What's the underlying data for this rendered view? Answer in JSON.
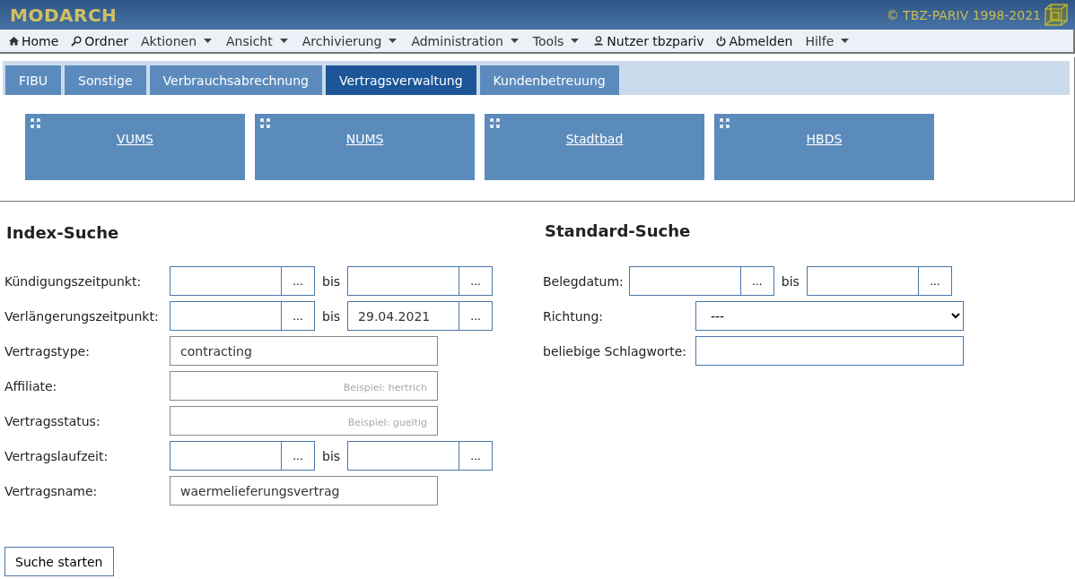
{
  "header": {
    "logo": "MODARCH",
    "copyright": "© TBZ-PARIV 1998-2021"
  },
  "menu": [
    {
      "label": "Home",
      "kind": "home"
    },
    {
      "label": "Ordner",
      "kind": "search"
    },
    {
      "label": "Aktionen",
      "kind": "dropdown"
    },
    {
      "label": "Ansicht",
      "kind": "dropdown"
    },
    {
      "label": "Archivierung",
      "kind": "dropdown"
    },
    {
      "label": "Administration",
      "kind": "dropdown"
    },
    {
      "label": "Tools",
      "kind": "dropdown"
    },
    {
      "label": "Nutzer tbzpariv",
      "kind": "user"
    },
    {
      "label": "Abmelden",
      "kind": "logout"
    },
    {
      "label": "Hilfe",
      "kind": "dropdown"
    }
  ],
  "tabs": [
    {
      "label": "FIBU",
      "selected": false
    },
    {
      "label": "Sonstige",
      "selected": false
    },
    {
      "label": "Verbrauchsabrechnung",
      "selected": false
    },
    {
      "label": "Vertragsverwaltung",
      "selected": true
    },
    {
      "label": "Kundenbetreuung",
      "selected": false
    }
  ],
  "tiles": [
    "VUMS",
    "NUMS",
    "Stadtbad",
    "HBDS"
  ],
  "index_search": {
    "title": "Index-Suche",
    "fields": [
      {
        "kind": "daterange",
        "label": "Kündigungszeitpunkt:",
        "picker": "...",
        "separator": "bis",
        "picker_2": "..."
      },
      {
        "kind": "daterange",
        "label": "Verlängerungszeitpunkt:",
        "picker": "...",
        "separator": "bis",
        "value_2": "29.04.2021",
        "picker_2": "..."
      },
      {
        "kind": "text",
        "label": "Vertragstype:",
        "value": "contracting"
      },
      {
        "kind": "text",
        "label": "Affiliate:",
        "placeholder": "Beispiel: hertrich"
      },
      {
        "kind": "text",
        "label": "Vertragsstatus:",
        "placeholder": "Beispiel: gueltig"
      },
      {
        "kind": "daterange",
        "label": "Vertragslaufzeit:",
        "picker": "...",
        "separator": "bis",
        "picker_2": "..."
      },
      {
        "kind": "text",
        "label": "Vertragsname:",
        "value": "waermelieferungsvertrag"
      }
    ],
    "button": "Suche starten"
  },
  "standard_search": {
    "title": "Standard-Suche",
    "fields": [
      {
        "kind": "daterange",
        "label": "Belegdatum:",
        "picker": "...",
        "separator": "bis",
        "picker_2": "..."
      },
      {
        "kind": "select",
        "label": "Richtung:",
        "value": "---"
      },
      {
        "kind": "text",
        "label": "beliebige Schlagworte:"
      }
    ]
  }
}
